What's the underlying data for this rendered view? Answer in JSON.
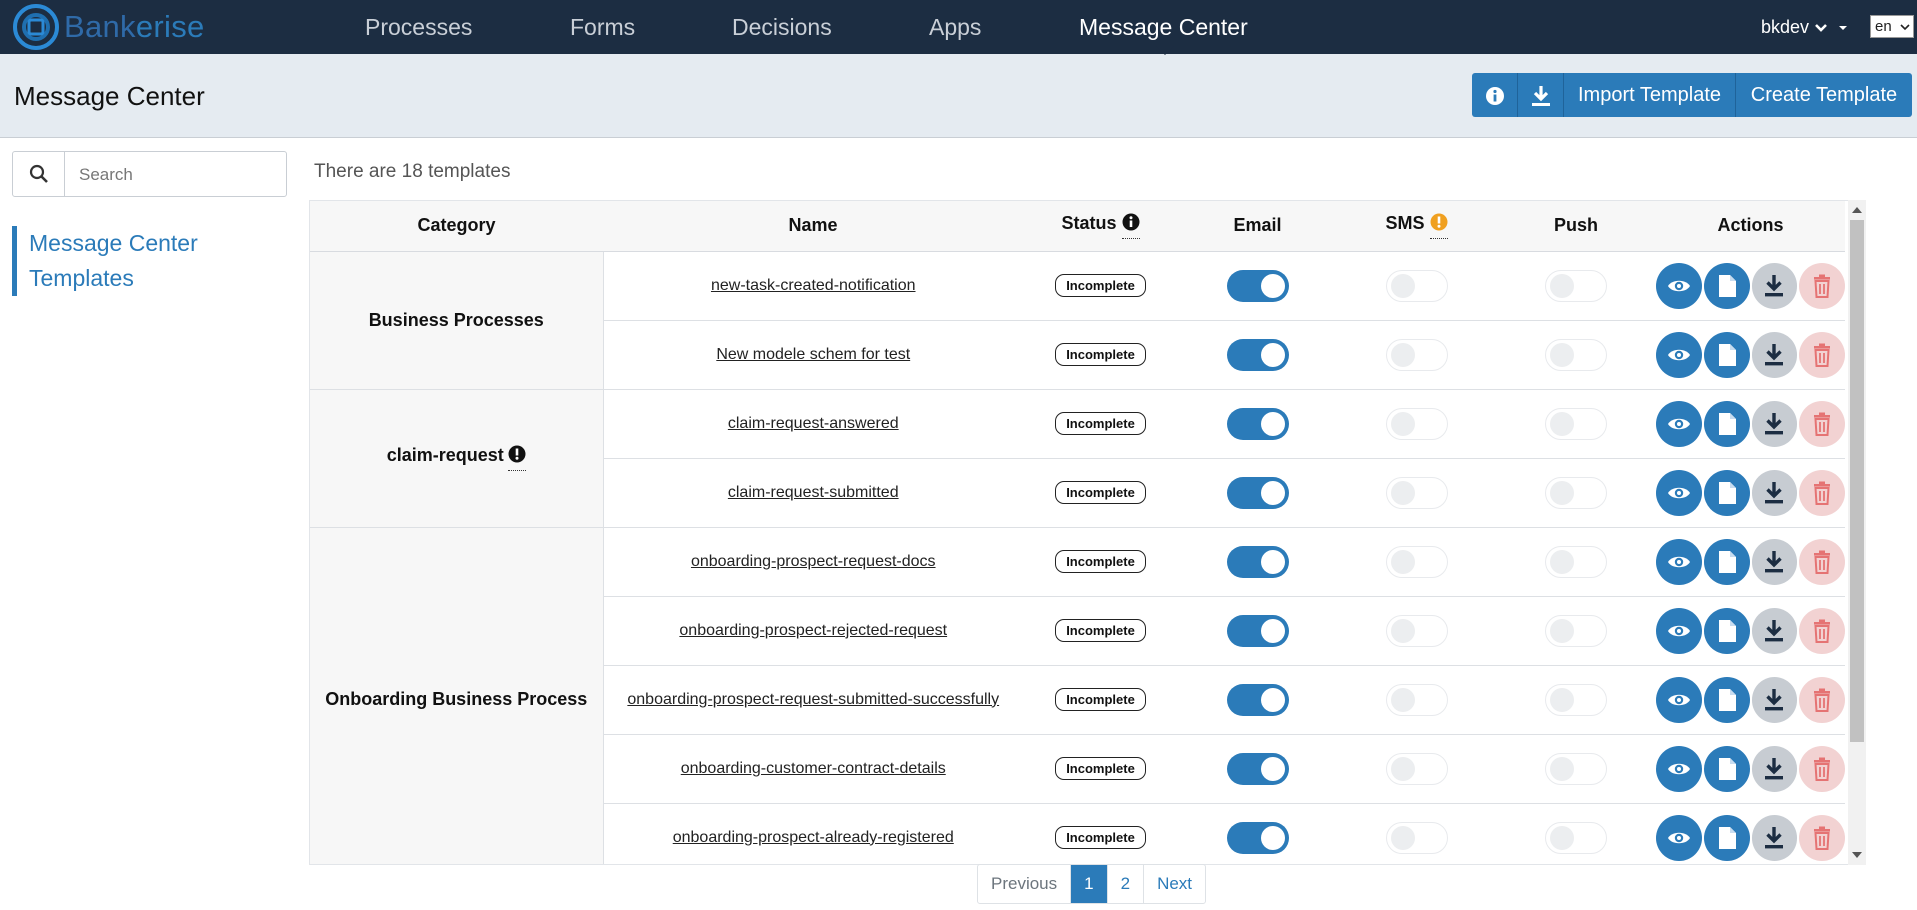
{
  "brand": {
    "name_part1": "Bank",
    "name_part2": "erise"
  },
  "nav": {
    "items": [
      {
        "label": "Processes"
      },
      {
        "label": "Forms"
      },
      {
        "label": "Decisions"
      },
      {
        "label": "Apps"
      },
      {
        "label": "Message Center"
      }
    ],
    "active": "Message Center",
    "user": "bkdev",
    "language": "en"
  },
  "header": {
    "title": "Message Center",
    "import_label": "Import Template",
    "create_label": "Create Template"
  },
  "sidebar": {
    "search_placeholder": "Search",
    "link_label": "Message Center Templates"
  },
  "main": {
    "count_text": "There are 18 templates",
    "columns": {
      "category": "Category",
      "name": "Name",
      "status": "Status",
      "email": "Email",
      "sms": "SMS",
      "push": "Push",
      "actions": "Actions"
    },
    "groups": [
      {
        "category": "Business Processes",
        "warning_icon": false,
        "templates": [
          {
            "name": "new-task-created-notification",
            "status": "Incomplete",
            "email": true,
            "sms": false,
            "push": false
          },
          {
            "name": "New modele schem for test",
            "status": "Incomplete",
            "email": true,
            "sms": false,
            "push": false
          }
        ]
      },
      {
        "category": "claim-request",
        "warning_icon": true,
        "templates": [
          {
            "name": "claim-request-answered",
            "status": "Incomplete",
            "email": true,
            "sms": false,
            "push": false
          },
          {
            "name": "claim-request-submitted",
            "status": "Incomplete",
            "email": true,
            "sms": false,
            "push": false
          }
        ]
      },
      {
        "category": "Onboarding Business Process",
        "warning_icon": false,
        "templates": [
          {
            "name": "onboarding-prospect-request-docs",
            "status": "Incomplete",
            "email": true,
            "sms": false,
            "push": false
          },
          {
            "name": "onboarding-prospect-rejected-request",
            "status": "Incomplete",
            "email": true,
            "sms": false,
            "push": false
          },
          {
            "name": "onboarding-prospect-request-submitted-successfully",
            "status": "Incomplete",
            "email": true,
            "sms": false,
            "push": false
          },
          {
            "name": "onboarding-customer-contract-details",
            "status": "Incomplete",
            "email": true,
            "sms": false,
            "push": false
          },
          {
            "name": "onboarding-prospect-already-registered",
            "status": "Incomplete",
            "email": true,
            "sms": false,
            "push": false
          }
        ]
      }
    ]
  },
  "pagination": {
    "previous": "Previous",
    "pages": [
      "1",
      "2"
    ],
    "current": "1",
    "next": "Next"
  },
  "colors": {
    "nav_bg": "#1c2d42",
    "accent": "#2b7bb9",
    "header_bg": "#e5ebf1",
    "delete_bg": "#f2d2d2",
    "delete_icon": "#e57373",
    "download_bg": "#c7ccd2",
    "sms_warning": "#f0a020"
  },
  "icons": {
    "logo": "bankerise-logo",
    "info": "info-icon",
    "download": "download-icon",
    "search": "search-icon",
    "view": "eye-icon",
    "file": "file-icon",
    "delete": "trash-icon",
    "warning": "exclamation-icon"
  }
}
